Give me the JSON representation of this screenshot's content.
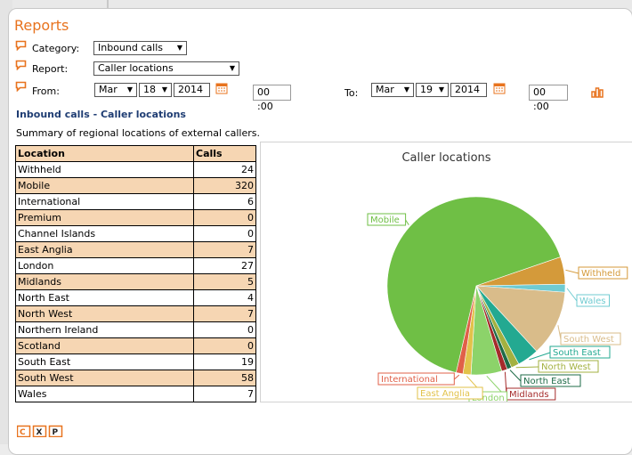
{
  "page": {
    "title": "Reports"
  },
  "form": {
    "category_label": "Category:",
    "category_value": "Inbound calls",
    "report_label": "Report:",
    "report_value": "Caller locations",
    "from_label": "From:",
    "to_label": "To:",
    "from": {
      "month": "Mar",
      "day": "18",
      "year": "2014",
      "time": "00 :00"
    },
    "to": {
      "month": "Mar",
      "day": "19",
      "year": "2014",
      "time": "00 :00"
    }
  },
  "report": {
    "heading": "Inbound calls - Caller locations",
    "summary": "Summary of regional locations of external callers."
  },
  "table": {
    "headers": [
      "Location",
      "Calls"
    ],
    "rows": [
      [
        "Withheld",
        "24"
      ],
      [
        "Mobile",
        "320"
      ],
      [
        "International",
        "6"
      ],
      [
        "Premium",
        "0"
      ],
      [
        "Channel Islands",
        "0"
      ],
      [
        "East Anglia",
        "7"
      ],
      [
        "London",
        "27"
      ],
      [
        "Midlands",
        "5"
      ],
      [
        "North East",
        "4"
      ],
      [
        "North West",
        "7"
      ],
      [
        "Northern Ireland",
        "0"
      ],
      [
        "Scotland",
        "0"
      ],
      [
        "South East",
        "19"
      ],
      [
        "South West",
        "58"
      ],
      [
        "Wales",
        "7"
      ]
    ],
    "footer_icons": [
      "csv-export-icon",
      "excel-export-icon",
      "pdf-export-icon"
    ]
  },
  "chart_data": {
    "type": "pie",
    "title": "Caller locations",
    "slices": [
      {
        "name": "Withheld",
        "value": 24,
        "color": "#d49a3a"
      },
      {
        "name": "Wales",
        "value": 7,
        "color": "#6fcbd1"
      },
      {
        "name": "South West",
        "value": 58,
        "color": "#d9bc8a"
      },
      {
        "name": "South East",
        "value": 19,
        "color": "#23a991"
      },
      {
        "name": "North West",
        "value": 7,
        "color": "#a3b140"
      },
      {
        "name": "North East",
        "value": 4,
        "color": "#1e6b47"
      },
      {
        "name": "Midlands",
        "value": 5,
        "color": "#a52b2b"
      },
      {
        "name": "London",
        "value": 27,
        "color": "#8cd36a"
      },
      {
        "name": "East Anglia",
        "value": 7,
        "color": "#e2c24a"
      },
      {
        "name": "International",
        "value": 6,
        "color": "#e06048"
      },
      {
        "name": "Mobile",
        "value": 320,
        "color": "#6fbf45"
      }
    ]
  }
}
